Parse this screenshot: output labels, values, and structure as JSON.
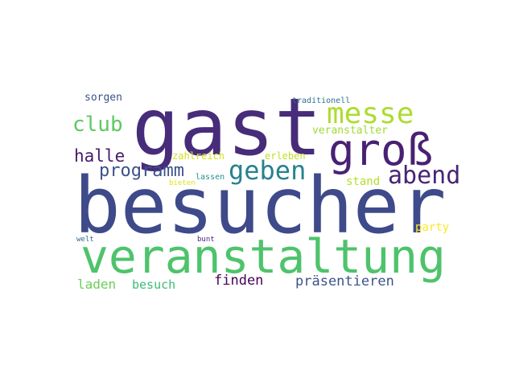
{
  "words": [
    {
      "text": "besucher",
      "color": "#3e4a89"
    },
    {
      "text": "gast",
      "color": "#472c7a"
    },
    {
      "text": "veranstaltung",
      "color": "#4ec36b"
    },
    {
      "text": "groß",
      "color": "#482173"
    },
    {
      "text": "messe",
      "color": "#addc30"
    },
    {
      "text": "geben",
      "color": "#26828e"
    },
    {
      "text": "abend",
      "color": "#482475"
    },
    {
      "text": "club",
      "color": "#5ec962"
    },
    {
      "text": "programm",
      "color": "#3b528b"
    },
    {
      "text": "halle",
      "color": "#481a6c"
    },
    {
      "text": "präsentieren",
      "color": "#3b528b"
    },
    {
      "text": "finden",
      "color": "#440154"
    },
    {
      "text": "laden",
      "color": "#6ccd5a"
    },
    {
      "text": "besuch",
      "color": "#3dbc74"
    },
    {
      "text": "stand",
      "color": "#b5de2b"
    },
    {
      "text": "party",
      "color": "#fde725"
    },
    {
      "text": "sorgen",
      "color": "#3b528b"
    },
    {
      "text": "veranstalter",
      "color": "#a2da37"
    },
    {
      "text": "zahlreich",
      "color": "#d2e21b"
    },
    {
      "text": "erleben",
      "color": "#c2df23"
    },
    {
      "text": "traditionell",
      "color": "#2c728e"
    },
    {
      "text": "lassen",
      "color": "#21918c"
    },
    {
      "text": "bieten",
      "color": "#dde318"
    },
    {
      "text": "welt",
      "color": "#31688e"
    },
    {
      "text": "bunt",
      "color": "#482878"
    }
  ]
}
